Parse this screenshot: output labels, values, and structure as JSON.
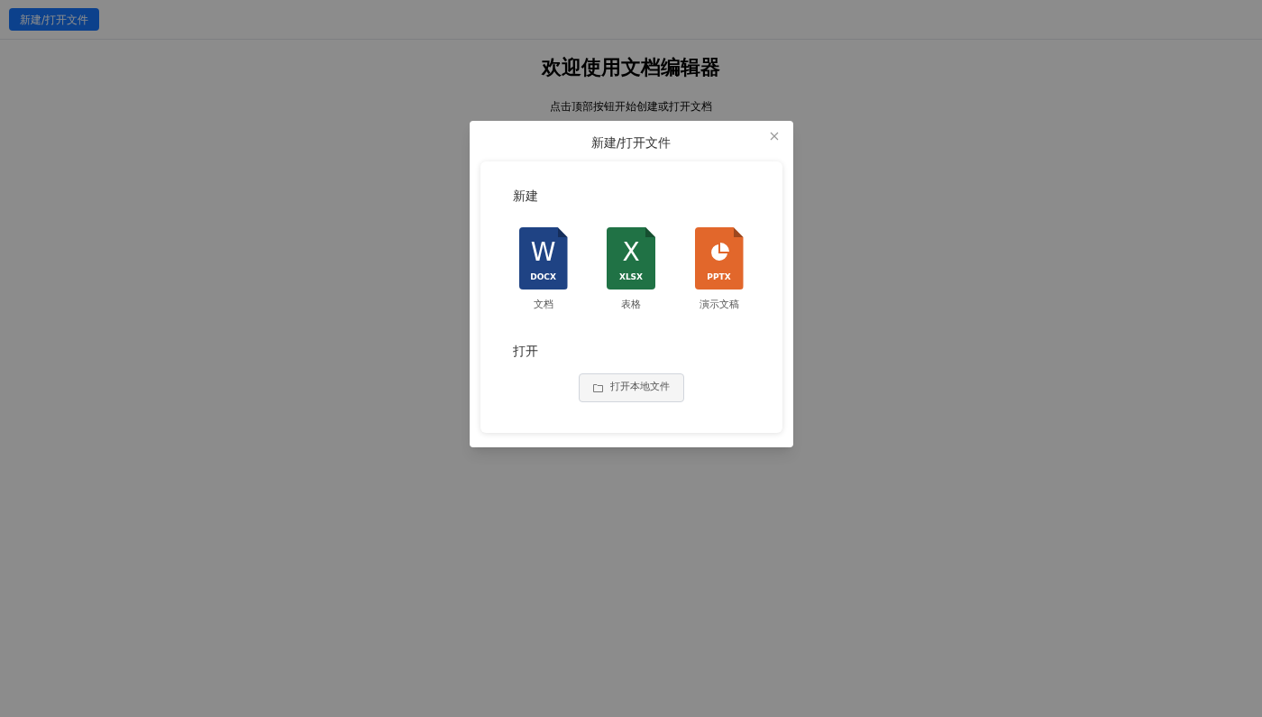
{
  "toolbar": {
    "button": "新建/打开文件"
  },
  "page": {
    "title": "欢迎使用文档编辑器",
    "subtitle": "点击顶部按钮开始创建或打开文档"
  },
  "dialog": {
    "title": "新建/打开文件",
    "new_section": "新建",
    "file_types": [
      {
        "kind": "docx",
        "glyph": "W",
        "ext": "DOCX",
        "label": "文档",
        "color": "#1f4384"
      },
      {
        "kind": "xlsx",
        "glyph": "X",
        "ext": "XLSX",
        "label": "表格",
        "color": "#207245"
      },
      {
        "kind": "pptx",
        "ext": "PPTX",
        "label": "演示文稿",
        "color": "#e2672b"
      }
    ],
    "open_section": "打开",
    "open_button": "打开本地文件"
  }
}
